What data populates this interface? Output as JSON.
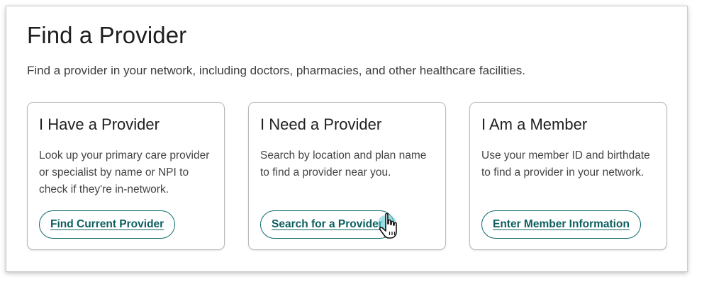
{
  "header": {
    "title": "Find a Provider",
    "subtitle": "Find a provider in your network, including doctors, pharmacies, and other healthcare facilities."
  },
  "cards": [
    {
      "title": "I Have a Provider",
      "description": "Look up your primary care provider or specialist by name or NPI to check if they're in-network.",
      "button_label": "Find Current Provider"
    },
    {
      "title": "I Need a Provider",
      "description": "Search by location and plan name to find a provider near you.",
      "button_label": "Search for a Provider"
    },
    {
      "title": "I Am a Member",
      "description": "Use your member ID and birthdate to find a provider in your network.",
      "button_label": "Enter Member Information"
    }
  ],
  "cursor": {
    "icon": "hand-pointer-icon"
  },
  "colors": {
    "accent": "#0d6b6b",
    "accent_text": "#0d5e5e",
    "cursor_highlight": "#5fc9cf"
  }
}
